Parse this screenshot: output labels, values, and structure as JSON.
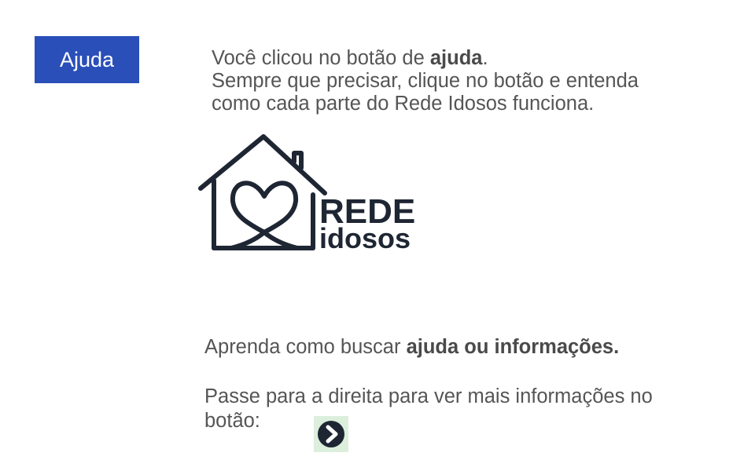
{
  "help_button": {
    "label": "Ajuda"
  },
  "intro": {
    "line1_prefix": "Você clicou no botão de ",
    "line1_bold": "ajuda",
    "line1_suffix": ".",
    "line2": "Sempre que precisar, clique no botão e entenda",
    "line3": "como cada parte do Rede Idosos funciona."
  },
  "logo": {
    "word1": "REDE",
    "word2": "idosos",
    "color": "#1f2633"
  },
  "learn": {
    "prefix": "Aprenda como buscar ",
    "bold": "ajuda ou informações."
  },
  "swipe": {
    "line1": "Passe para a direita para ver mais informações no",
    "line2": "botão:"
  },
  "next_button": {
    "icon": "chevron-right-circle-icon"
  },
  "colors": {
    "accent": "#2a4fb8",
    "text": "#555555",
    "next_bg": "#dcefdc",
    "logo": "#1f2633"
  }
}
